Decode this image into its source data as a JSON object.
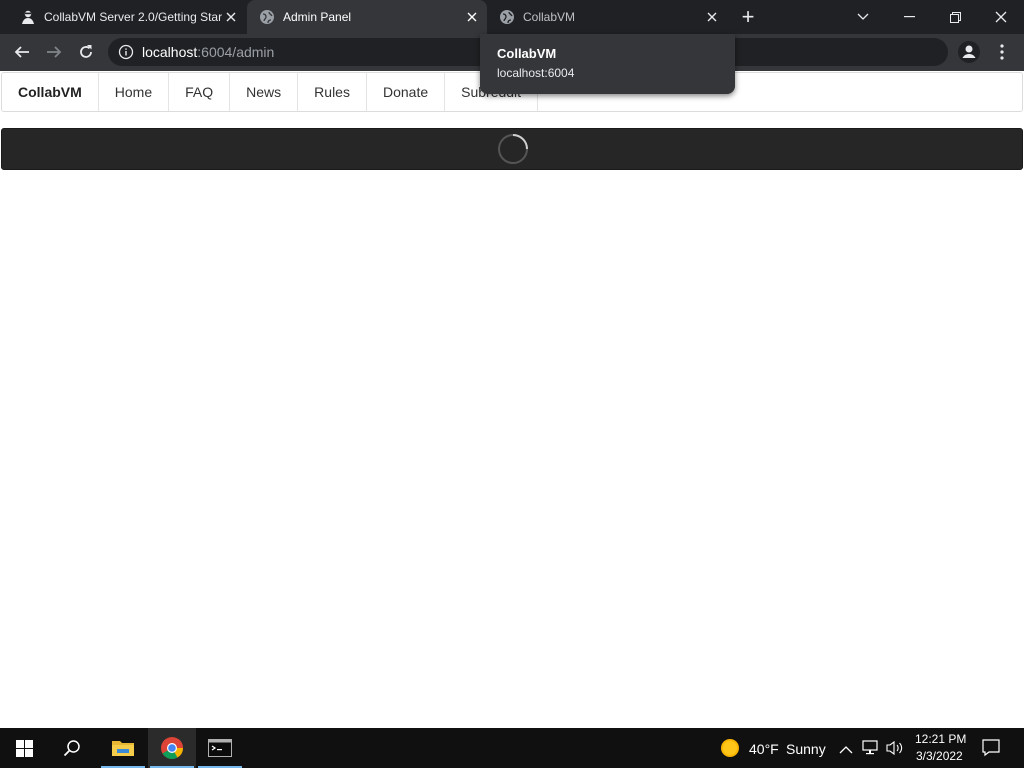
{
  "browser": {
    "tabs": [
      {
        "title": "CollabVM Server 2.0/Getting Star",
        "favicon": "collabvm-favicon-icon",
        "active": false
      },
      {
        "title": "Admin Panel",
        "favicon": "globe-icon",
        "active": true
      },
      {
        "title": "CollabVM",
        "favicon": "globe-icon",
        "active": false
      }
    ],
    "new_tab_symbol": "+",
    "close_symbol": "✕",
    "address": {
      "host": "localhost",
      "path": ":6004/admin"
    },
    "hover_card": {
      "title": "CollabVM",
      "url": "localhost:6004"
    }
  },
  "site": {
    "nav": [
      {
        "label": "CollabVM",
        "brand": true
      },
      {
        "label": "Home"
      },
      {
        "label": "FAQ"
      },
      {
        "label": "News"
      },
      {
        "label": "Rules"
      },
      {
        "label": "Donate"
      },
      {
        "label": "Subreddit"
      }
    ],
    "loading": true
  },
  "taskbar": {
    "weather": {
      "temp": "40°F",
      "condition": "Sunny"
    },
    "clock": {
      "time": "12:21 PM",
      "date": "3/3/2022"
    }
  },
  "colors": {
    "tabstrip": "#202124",
    "toolbar": "#35363a",
    "loadbar": "#262626",
    "taskbar": "#101010",
    "accent": "#76b9ed"
  }
}
